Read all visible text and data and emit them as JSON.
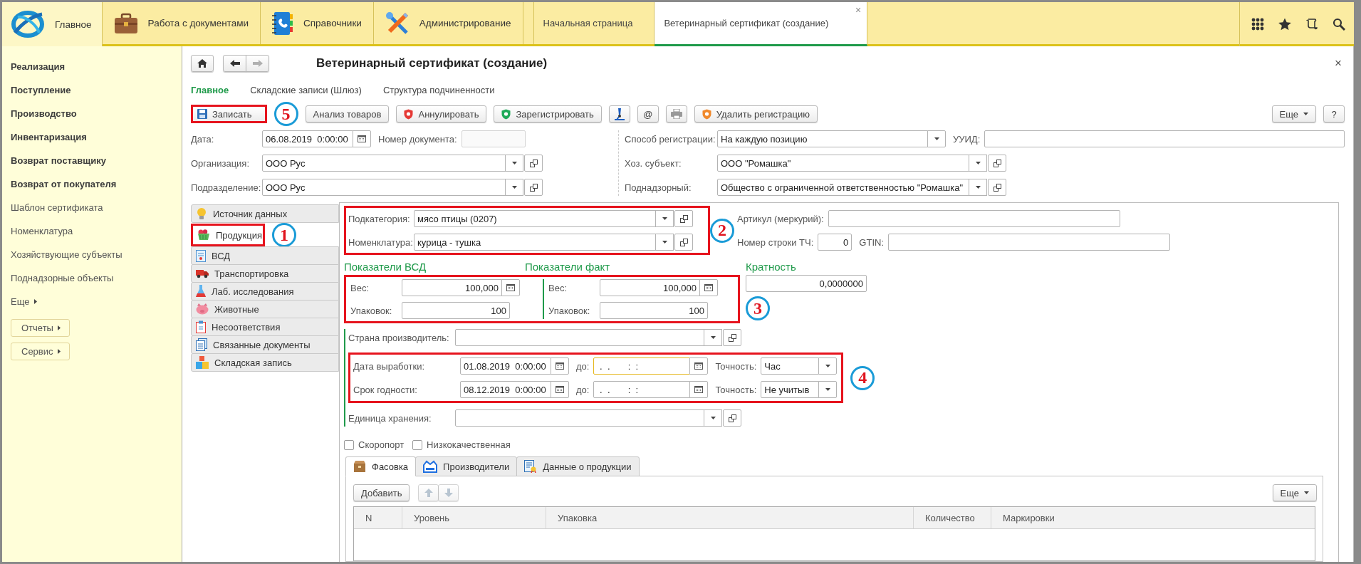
{
  "top_bar": {
    "sections": [
      {
        "label": "Главное",
        "selected": true
      },
      {
        "label": "Работа с документами",
        "selected": false
      },
      {
        "label": "Справочники",
        "selected": false
      },
      {
        "label": "Администрирование",
        "selected": false
      }
    ],
    "open_tabs": [
      {
        "label": "Начальная страница",
        "selected": false
      },
      {
        "label": "Ветеринарный сертификат (создание)",
        "selected": true,
        "close": "×"
      }
    ]
  },
  "sidebar": {
    "items": [
      {
        "label": "Реализация",
        "kind": "section"
      },
      {
        "label": "Поступление",
        "kind": "section"
      },
      {
        "label": "Производство",
        "kind": "section"
      },
      {
        "label": "Инвентаризация",
        "kind": "section"
      },
      {
        "label": "Возврат поставщику",
        "kind": "section"
      },
      {
        "label": "Возврат от покупателя",
        "kind": "section"
      },
      {
        "label": "Шаблон сертификата",
        "kind": "link"
      },
      {
        "label": "Номенклатура",
        "kind": "link"
      },
      {
        "label": "Хозяйствующие субъекты",
        "kind": "link"
      },
      {
        "label": "Поднадзорные объекты",
        "kind": "link"
      }
    ],
    "more": "Еще",
    "buttons": [
      "Отчеты",
      "Сервис"
    ]
  },
  "form": {
    "title": "Ветеринарный сертификат (создание)",
    "close": "×",
    "nav": {
      "back_disabled": false,
      "forward_disabled": true
    },
    "tabs": [
      {
        "label": "Главное",
        "selected": true
      },
      {
        "label": "Складские записи (Шлюз)",
        "selected": false
      },
      {
        "label": "Структура подчиненности",
        "selected": false
      }
    ],
    "toolbar": {
      "save": {
        "label": "Записать",
        "annotation": "5"
      },
      "buttons": [
        "Анализ товаров",
        "Аннулировать",
        "Зарегистрировать"
      ],
      "email": "@",
      "delete_registration": "Удалить регистрацию",
      "more": "Еще",
      "help": "?"
    },
    "header_fields": {
      "date": {
        "label": "Дата:",
        "value": "06.08.2019  0:00:00"
      },
      "doc_number": {
        "label": "Номер документа:"
      },
      "organization": {
        "label": "Организация:",
        "value": "ООО Рус"
      },
      "division": {
        "label": "Подразделение:",
        "value": "ООО Рус"
      },
      "registration_method": {
        "label": "Способ регистрации:",
        "value": "На каждую позицию"
      },
      "uuid": {
        "label": "УУИД:"
      },
      "business_entity": {
        "label": "Хоз. субъект:",
        "value": "ООО \"Ромашка\""
      },
      "supervised": {
        "label": "Поднадзорный:",
        "value": "Общество с ограниченной ответственностью \"Ромашка\""
      }
    },
    "sections": [
      {
        "label": "Источник данных",
        "selected": false
      },
      {
        "label": "Продукция",
        "selected": true,
        "annotation": "1"
      },
      {
        "label": "ВСД",
        "selected": false
      },
      {
        "label": "Транспортировка",
        "selected": false
      },
      {
        "label": "Лаб. исследования",
        "selected": false
      },
      {
        "label": "Животные",
        "selected": false
      },
      {
        "label": "Несоответствия",
        "selected": false
      },
      {
        "label": "Связанные документы",
        "selected": false
      },
      {
        "label": "Складская запись",
        "selected": false
      }
    ],
    "product": {
      "annotation": "2",
      "subcategory": {
        "label": "Подкатегория:",
        "value": "мясо птицы (0207)"
      },
      "nomenclature": {
        "label": "Номенклатура:",
        "value": "курица - тушка"
      },
      "article": {
        "label": "Артикул (меркурий):"
      },
      "row_number": {
        "label": "Номер строки ТЧ:",
        "value": "0"
      },
      "gtin": {
        "label": "GTIN:"
      },
      "indicators": {
        "annotation": "3",
        "vsd": {
          "title": "Показатели ВСД",
          "weight": {
            "label": "Вес:",
            "value": "100,000"
          },
          "packages": {
            "label": "Упаковок:",
            "value": "100"
          }
        },
        "fact": {
          "title": "Показатели факт",
          "weight": {
            "label": "Вес:",
            "value": "100,000"
          },
          "packages": {
            "label": "Упаковок:",
            "value": "100"
          }
        }
      },
      "multiplicity": {
        "title": "Кратность",
        "value": "0,0000000"
      },
      "country": {
        "label": "Страна производитель:"
      },
      "dates": {
        "annotation": "4",
        "rows": [
          {
            "label": "Дата выработки:",
            "value": "01.08.2019  0:00:00",
            "to_label": "до:",
            "to_value": " .  .       :  :",
            "focused": true,
            "precision_label": "Точность:",
            "precision": "Час"
          },
          {
            "label": "Срок годности:",
            "value": "08.12.2019  0:00:00",
            "to_label": "до:",
            "to_value": " .  .       :  :",
            "focused": false,
            "precision_label": "Точность:",
            "precision": "Не учитыв"
          }
        ]
      },
      "storage_unit": {
        "label": "Единица хранения:"
      },
      "checkboxes": [
        {
          "label": "Скоропорт",
          "checked": false
        },
        {
          "label": "Низкокачественная",
          "checked": false
        }
      ],
      "tabs": [
        {
          "label": "Фасовка",
          "selected": true
        },
        {
          "label": "Производители",
          "selected": false
        },
        {
          "label": "Данные о продукции",
          "selected": false
        }
      ],
      "table": {
        "add": "Добавить",
        "more": "Еще",
        "columns": [
          "N",
          "Уровень",
          "Упаковка",
          "Количество",
          "Маркировки"
        ]
      }
    }
  }
}
